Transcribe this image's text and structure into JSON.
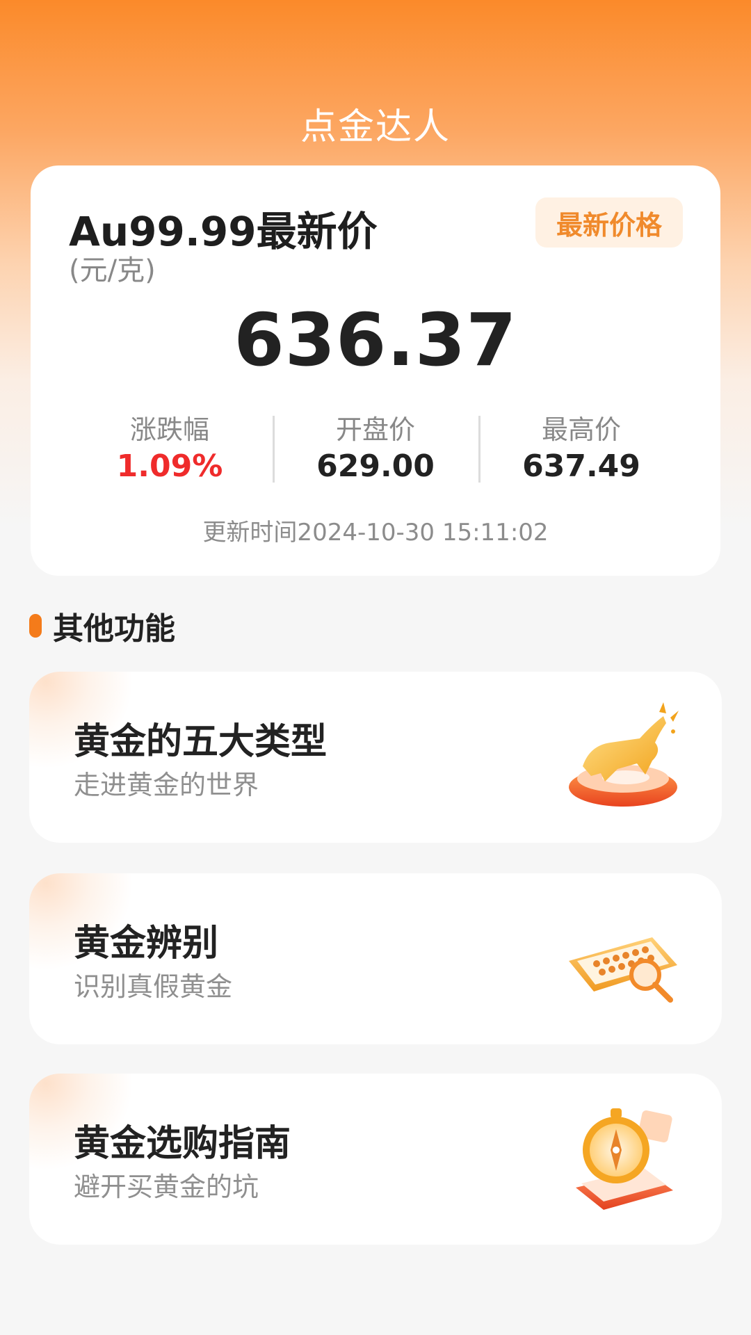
{
  "app": {
    "title": "点金达人"
  },
  "price_card": {
    "title": "Au99.99最新价",
    "unit": "(元/克)",
    "badge": "最新价格",
    "price": "636.37",
    "stats": [
      {
        "label": "涨跌幅",
        "value": "1.09%"
      },
      {
        "label": "开盘价",
        "value": "629.00"
      },
      {
        "label": "最高价",
        "value": "637.49"
      }
    ],
    "update_time": "更新时间2024-10-30 15:11:02"
  },
  "section": {
    "title": "其他功能"
  },
  "features": [
    {
      "title": "黄金的五大类型",
      "subtitle": "走进黄金的世界",
      "icon": "golden-bull-icon"
    },
    {
      "title": "黄金辨别",
      "subtitle": "识别真假黄金",
      "icon": "abacus-magnifier-icon"
    },
    {
      "title": "黄金选购指南",
      "subtitle": "避开买黄金的坑",
      "icon": "compass-book-icon"
    }
  ],
  "colors": {
    "accent": "#f47b1a",
    "up": "#ef2b2b",
    "badge_bg": "#fff1e3",
    "badge_text": "#f08a2c"
  }
}
